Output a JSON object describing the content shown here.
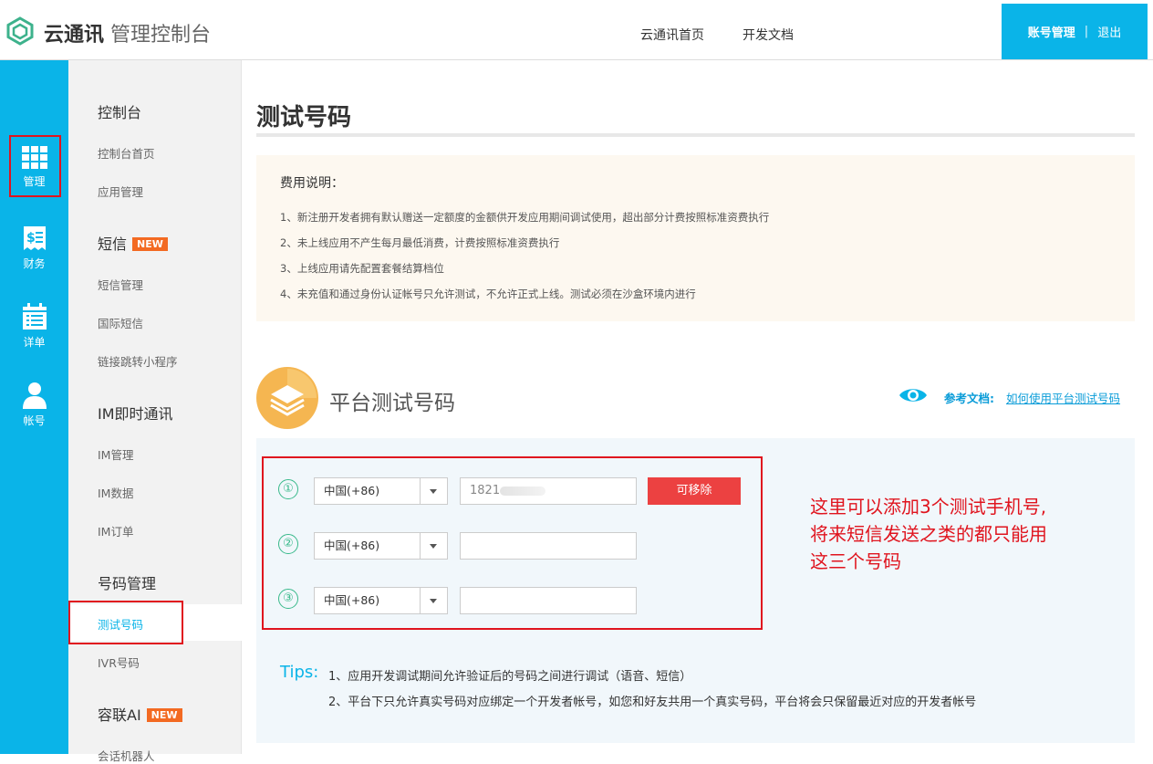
{
  "header": {
    "brand_main": "云通讯",
    "brand_sub": "管理控制台",
    "nav": [
      "云通讯首页",
      "开发文档"
    ],
    "account": "账号管理",
    "separator": "|",
    "logout": "退出"
  },
  "leftbar": [
    {
      "label": "管理",
      "icon": "grid-icon"
    },
    {
      "label": "财务",
      "icon": "receipt-icon"
    },
    {
      "label": "详单",
      "icon": "calendar-list-icon"
    },
    {
      "label": "帐号",
      "icon": "user-icon"
    }
  ],
  "subnav": {
    "console": "控制台",
    "console_items": [
      "控制台首页",
      "应用管理"
    ],
    "sms": "短信",
    "new_badge": "NEW",
    "sms_items": [
      "短信管理",
      "国际短信",
      "链接跳转小程序"
    ],
    "im": "IM即时通讯",
    "im_items": [
      "IM管理",
      "IM数据",
      "IM订单"
    ],
    "number": "号码管理",
    "number_active": "测试号码",
    "number_items": [
      "IVR号码"
    ],
    "ai": "容联AI",
    "ai_items": [
      "会话机器人"
    ]
  },
  "main": {
    "title": "测试号码",
    "fee": {
      "title": "费用说明：",
      "lines": [
        "1、新注册开发者拥有默认赠送一定额度的金额供开发应用期间调试使用，超出部分计费按照标准资费执行",
        "2、未上线应用不产生每月最低消费，计费按照标准资费执行",
        "3、上线应用请先配置套餐结算档位",
        "4、未充值和通过身份认证帐号只允许测试，不允许正式上线。测试必须在沙盒环境内进行"
      ]
    },
    "section_title": "平台测试号码",
    "ref_label": "参考文档:",
    "ref_link": "如何使用平台测试号码",
    "rows": [
      {
        "num": "①",
        "country": "中国(+86)",
        "phone": "1821",
        "remove": "可移除"
      },
      {
        "num": "②",
        "country": "中国(+86)",
        "phone": ""
      },
      {
        "num": "③",
        "country": "中国(+86)",
        "phone": ""
      }
    ],
    "annotation": [
      "这里可以添加3个测试手机号,",
      "将来短信发送之类的都只能用",
      "这三个号码"
    ],
    "tips_label": "Tips:",
    "tips": [
      "1、应用开发调试期间允许验证后的号码之间进行调试（语音、短信）",
      "2、平台下只允许真实号码对应绑定一个开发者帐号，如您和好友共用一个真实号码，平台将会只保留最近对应的开发者帐号"
    ]
  },
  "colors": {
    "accent": "#0ab4e8",
    "danger": "#ec4141",
    "annotation_red": "#e0141e",
    "badge": "#f36a22"
  }
}
